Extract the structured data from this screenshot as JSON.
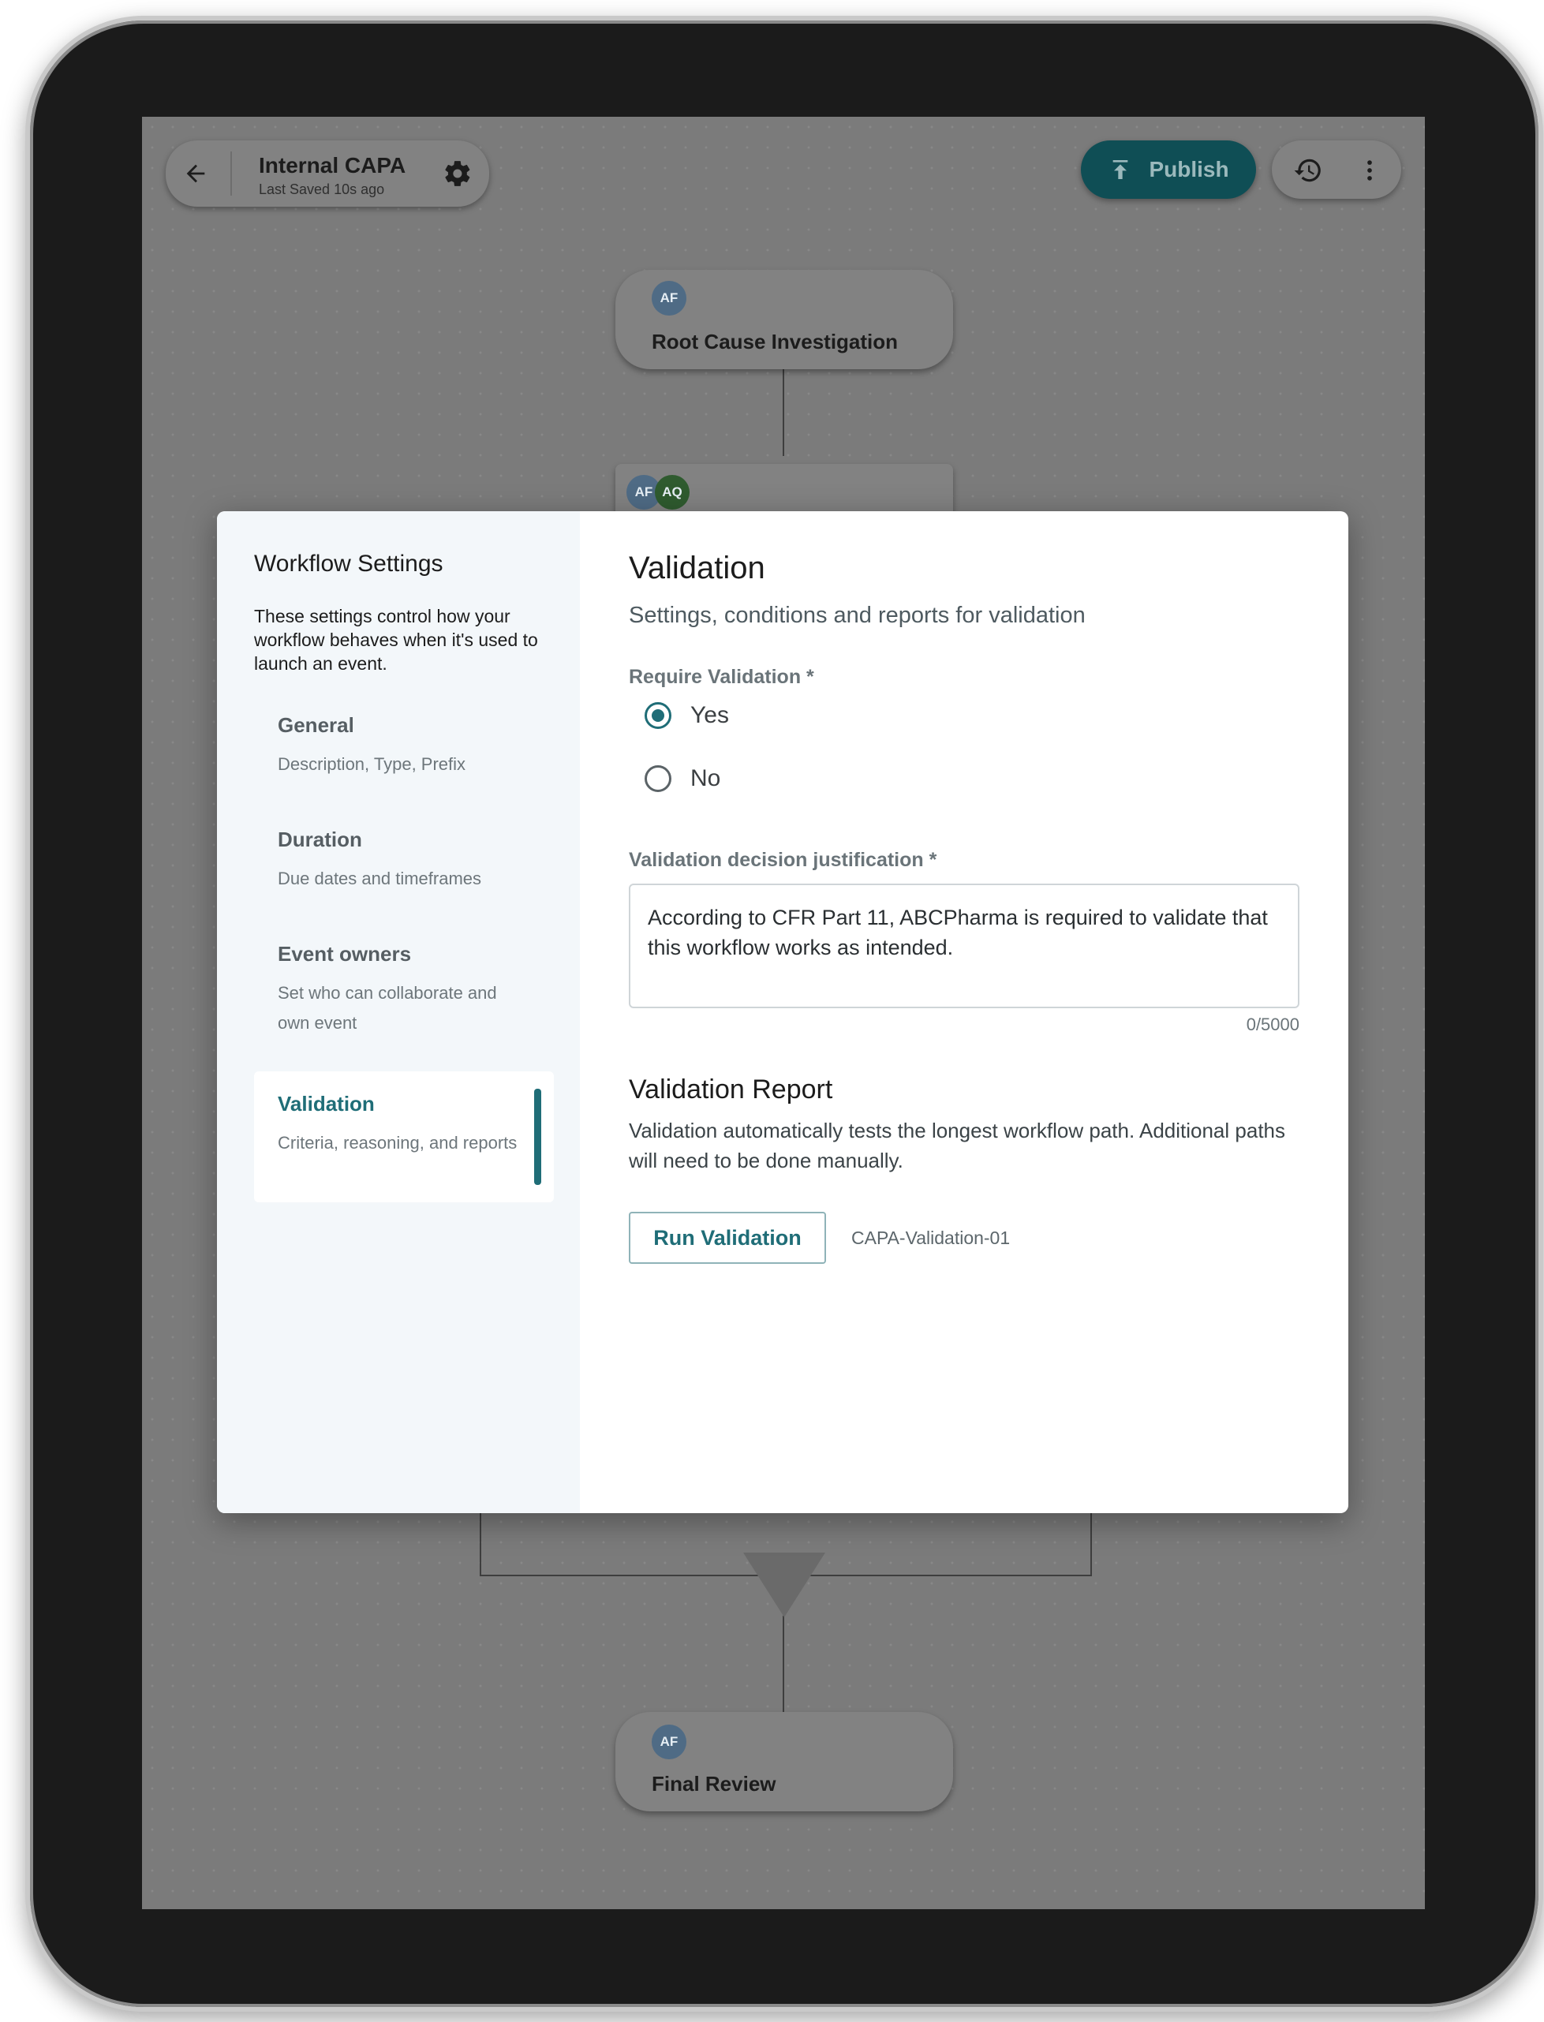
{
  "app": {
    "workflow_title": "Internal CAPA",
    "last_saved": "Last Saved 10s ago",
    "publish_label": "Publish",
    "icons": {
      "back": "arrow-left-icon",
      "settings": "gear-icon",
      "publish": "upload-icon",
      "history": "history-icon",
      "more": "more-vertical-icon"
    }
  },
  "canvas": {
    "nodes": [
      {
        "label": "Root Cause Investigation",
        "avatars": [
          "AF"
        ]
      },
      {
        "label": "",
        "avatars": [
          "AF",
          "AQ"
        ]
      },
      {
        "label": "Final Review",
        "avatars": [
          "AF"
        ]
      }
    ]
  },
  "modal": {
    "sidebar": {
      "title": "Workflow Settings",
      "description": "These settings control how your workflow behaves when it's used to launch an event.",
      "items": [
        {
          "title": "General",
          "subtitle": "Description, Type, Prefix"
        },
        {
          "title": "Duration",
          "subtitle": "Due dates and timeframes"
        },
        {
          "title": "Event owners",
          "subtitle": "Set who can collaborate and own event"
        },
        {
          "title": "Validation",
          "subtitle": "Criteria, reasoning, and reports",
          "active": true
        }
      ]
    },
    "content": {
      "title": "Validation",
      "subtitle": "Settings, conditions and reports for validation",
      "require_label": "Require Validation *",
      "options": [
        "Yes",
        "No"
      ],
      "selected": "Yes",
      "justification_label": "Validation decision justification *",
      "justification_value": "According to CFR Part 11, ABCPharma is required to validate that this workflow works as intended.",
      "counter": "0/5000",
      "report_title": "Validation Report",
      "report_desc": "Validation automatically tests the longest workflow path. Additional paths will need to be done manually.",
      "run_button": "Run Validation",
      "report_name": "CAPA-Validation-01"
    }
  },
  "colors": {
    "accent": "#1f6d77",
    "publish_bg": "#0f4e55",
    "overlay": "#7b7b7b"
  }
}
